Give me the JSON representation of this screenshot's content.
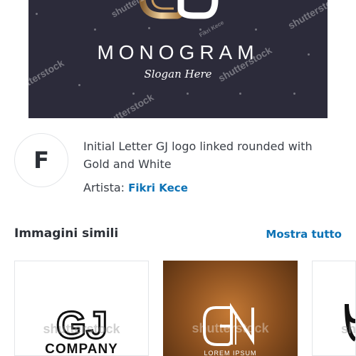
{
  "hero": {
    "title": "MONOGRAM",
    "slogan": "Slogan Here",
    "watermark": "shutterstock",
    "watermark_author": "Fikri Kece"
  },
  "contributor": {
    "avatar_letter": "F",
    "description": "Initial Letter GJ logo linked rounded with Gold and White",
    "artist_label": "Artista:",
    "artist_name": "Fikri Kece"
  },
  "similar": {
    "title": "Immagini simili",
    "show_all": "Mostra tutto",
    "items": [
      {
        "logo_text": "GJ",
        "caption": "COMPANY",
        "watermark": "shutterstock"
      },
      {
        "caption": "LOREM IPSUM",
        "watermark": "shutterstock"
      },
      {
        "watermark": "shutterstock"
      }
    ]
  },
  "colors": {
    "hero_bg": "#2c2b3a",
    "link": "#0c72b5",
    "gold": "#c99b5e"
  }
}
